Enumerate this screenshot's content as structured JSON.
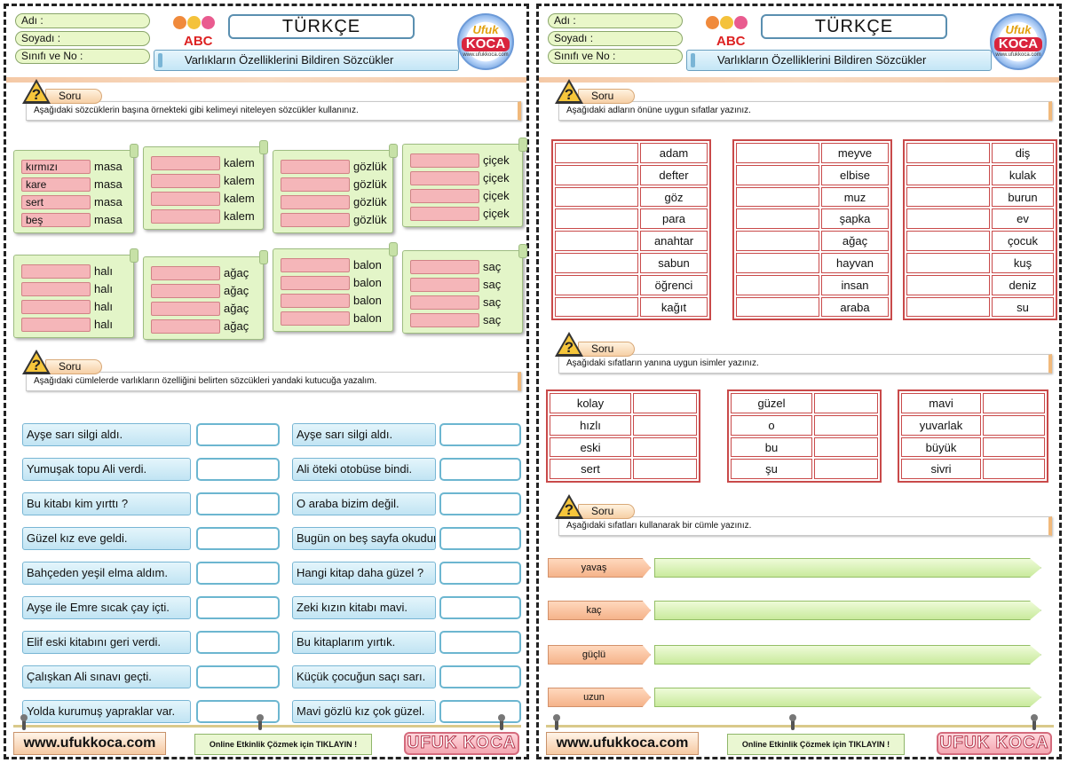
{
  "pages": [
    {
      "header": {
        "fields": [
          "Adı :",
          "Soyadı :",
          "Sınıfı ve No :"
        ],
        "subject": "TÜRKÇE",
        "subtitle": "Varlıkların Özelliklerini Bildiren Sözcükler",
        "abc": "ABC",
        "logo": {
          "line1": "Ufuk",
          "line2": "KOCA",
          "line3": "www.ufukkoca.com"
        }
      },
      "footer": {
        "website": "www.ufukkoca.com",
        "online": "Online Etkinlik Çözmek için TIKLAYIN !",
        "brand": "UFUK KOCA"
      }
    },
    {
      "header": {
        "fields": [
          "Adı :",
          "Soyadı :",
          "Sınıfı ve No :"
        ],
        "subject": "TÜRKÇE",
        "subtitle": "Varlıkların Özelliklerini Bildiren Sözcükler",
        "abc": "ABC",
        "logo": {
          "line1": "Ufuk",
          "line2": "KOCA",
          "line3": "www.ufukkoca.com"
        }
      },
      "footer": {
        "website": "www.ufukkoca.com",
        "online": "Online Etkinlik Çözmek için TIKLAYIN !",
        "brand": "UFUK KOCA"
      }
    }
  ],
  "left": {
    "q1": {
      "label": "Soru",
      "instruction": "Aşağıdaki sözcüklerin başına örnekteki gibi kelimeyi niteleyen sözcükler kullanınız.",
      "example_adjectives": [
        "kırmızı",
        "kare",
        "sert",
        "beş"
      ],
      "cards": [
        "masa",
        "kalem",
        "gözlük",
        "çiçek",
        "halı",
        "ağaç",
        "balon",
        "saç"
      ]
    },
    "q2": {
      "label": "Soru",
      "instruction": "Aşağıdaki cümlelerde varlıkların özelliğini belirten sözcükleri yandaki kutucuğa yazalım.",
      "col1": [
        "Ayşe sarı silgi aldı.",
        "Yumuşak topu Ali verdi.",
        "Bu kitabı kim yırttı ?",
        "Güzel kız eve geldi.",
        "Bahçeden yeşil elma aldım.",
        "Ayşe ile Emre sıcak çay içti.",
        "Elif eski kitabını geri verdi.",
        "Çalışkan Ali sınavı geçti.",
        "Yolda kurumuş yapraklar var."
      ],
      "col2": [
        "Ayşe sarı silgi aldı.",
        "Ali öteki otobüse bindi.",
        "O araba bizim değil.",
        "Bugün on beş sayfa okudum.",
        "Hangi kitap daha güzel ?",
        "Zeki kızın kitabı mavi.",
        "Bu kitaplarım yırtık.",
        "Küçük çocuğun saçı sarı.",
        "Mavi gözlü kız çok güzel."
      ]
    }
  },
  "right": {
    "q1": {
      "label": "Soru",
      "instruction": "Aşağıdaki adların önüne uygun sıfatlar yazınız.",
      "tables": [
        [
          "adam",
          "defter",
          "göz",
          "para",
          "anahtar",
          "sabun",
          "öğrenci",
          "kağıt"
        ],
        [
          "meyve",
          "elbise",
          "muz",
          "şapka",
          "ağaç",
          "hayvan",
          "insan",
          "araba"
        ],
        [
          "diş",
          "kulak",
          "burun",
          "ev",
          "çocuk",
          "kuş",
          "deniz",
          "su"
        ]
      ]
    },
    "q2": {
      "label": "Soru",
      "instruction": "Aşağıdaki sıfatların yanına uygun isimler yazınız.",
      "tables": [
        [
          "kolay",
          "hızlı",
          "eski",
          "sert"
        ],
        [
          "güzel",
          "o",
          "bu",
          "şu"
        ],
        [
          "mavi",
          "yuvarlak",
          "büyük",
          "sivri"
        ]
      ]
    },
    "q3": {
      "label": "Soru",
      "instruction": "Aşağıdaki sıfatları kullanarak bir cümle yazınız.",
      "words": [
        "yavaş",
        "kaç",
        "güçlü",
        "uzun"
      ]
    }
  }
}
